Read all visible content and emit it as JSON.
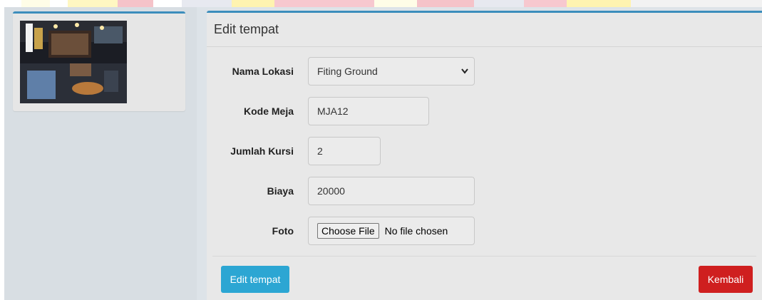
{
  "colors": {
    "accent": "#3c8dbc",
    "edit_button": "#2ca6d3",
    "back_button": "#cf1f1f",
    "header_stripes": [
      "#fffde7",
      "#f5c3c9",
      "#fff7c2",
      "#f5c3c9",
      "#e7e9f0",
      "#fff3b0",
      "#f7c8cf",
      "#f2f2f2"
    ]
  },
  "thumbnail": {
    "icon": "restaurant-photo"
  },
  "form": {
    "title": "Edit tempat",
    "fields": {
      "nama_lokasi": {
        "label": "Nama Lokasi",
        "value": "Fiting Ground"
      },
      "kode_meja": {
        "label": "Kode Meja",
        "value": "MJA12"
      },
      "jumlah_kursi": {
        "label": "Jumlah Kursi",
        "value": "2"
      },
      "biaya": {
        "label": "Biaya",
        "value": "20000"
      },
      "foto": {
        "label": "Foto",
        "button": "Choose File",
        "status": "No file chosen"
      }
    },
    "submit_label": "Edit tempat",
    "back_label": "Kembali"
  }
}
